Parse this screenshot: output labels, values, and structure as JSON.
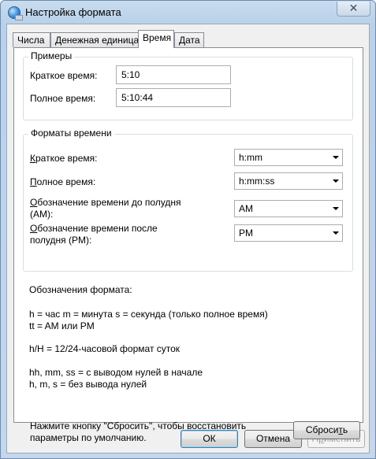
{
  "window": {
    "title": "Настройка формата",
    "close_label": "✕"
  },
  "tabs": [
    {
      "label": "Числа"
    },
    {
      "label": "Денежная единица"
    },
    {
      "label": "Время"
    },
    {
      "label": "Дата"
    }
  ],
  "examples": {
    "legend": "Примеры",
    "short_label": "Краткое время:",
    "short_value": "5:10",
    "long_label": "Полное время:",
    "long_value": "5:10:44"
  },
  "formats": {
    "legend": "Форматы времени",
    "short_label_first": "К",
    "short_label_rest": "раткое время:",
    "short_value": "h:mm",
    "long_label_first": "П",
    "long_label_rest": "олное время:",
    "long_value": "h:mm:ss",
    "am_label_first": "О",
    "am_label_rest": "бозначение времени до полудня",
    "am_label_line2": "(AM):",
    "am_value": "AM",
    "pm_label_first": "О",
    "pm_label_rest": "бозначение времени после",
    "pm_label_line2": "полудня (PM):",
    "pm_value": "PM"
  },
  "notation": {
    "heading": "Обозначения формата:",
    "line1": "h = час   m = минута   s = секунда (только полное время)",
    "line2": "tt = AM или PM",
    "line3": "h/H = 12/24-часовой формат суток",
    "line4": "hh, mm, ss = с выводом нулей в начале",
    "line5": "h, m, s = без вывода нулей"
  },
  "reset": {
    "hint_line1": "Нажмите кнопку \"Сбросить\", чтобы восстановить",
    "hint_line2": "параметры по умолчанию.",
    "button_rest": "Сброси",
    "button_underlined": "т",
    "button_end": "ь"
  },
  "buttons": {
    "ok": "ОК",
    "cancel": "Отмена",
    "apply_first": "П",
    "apply_underlined": "р",
    "apply_rest": "именить"
  }
}
